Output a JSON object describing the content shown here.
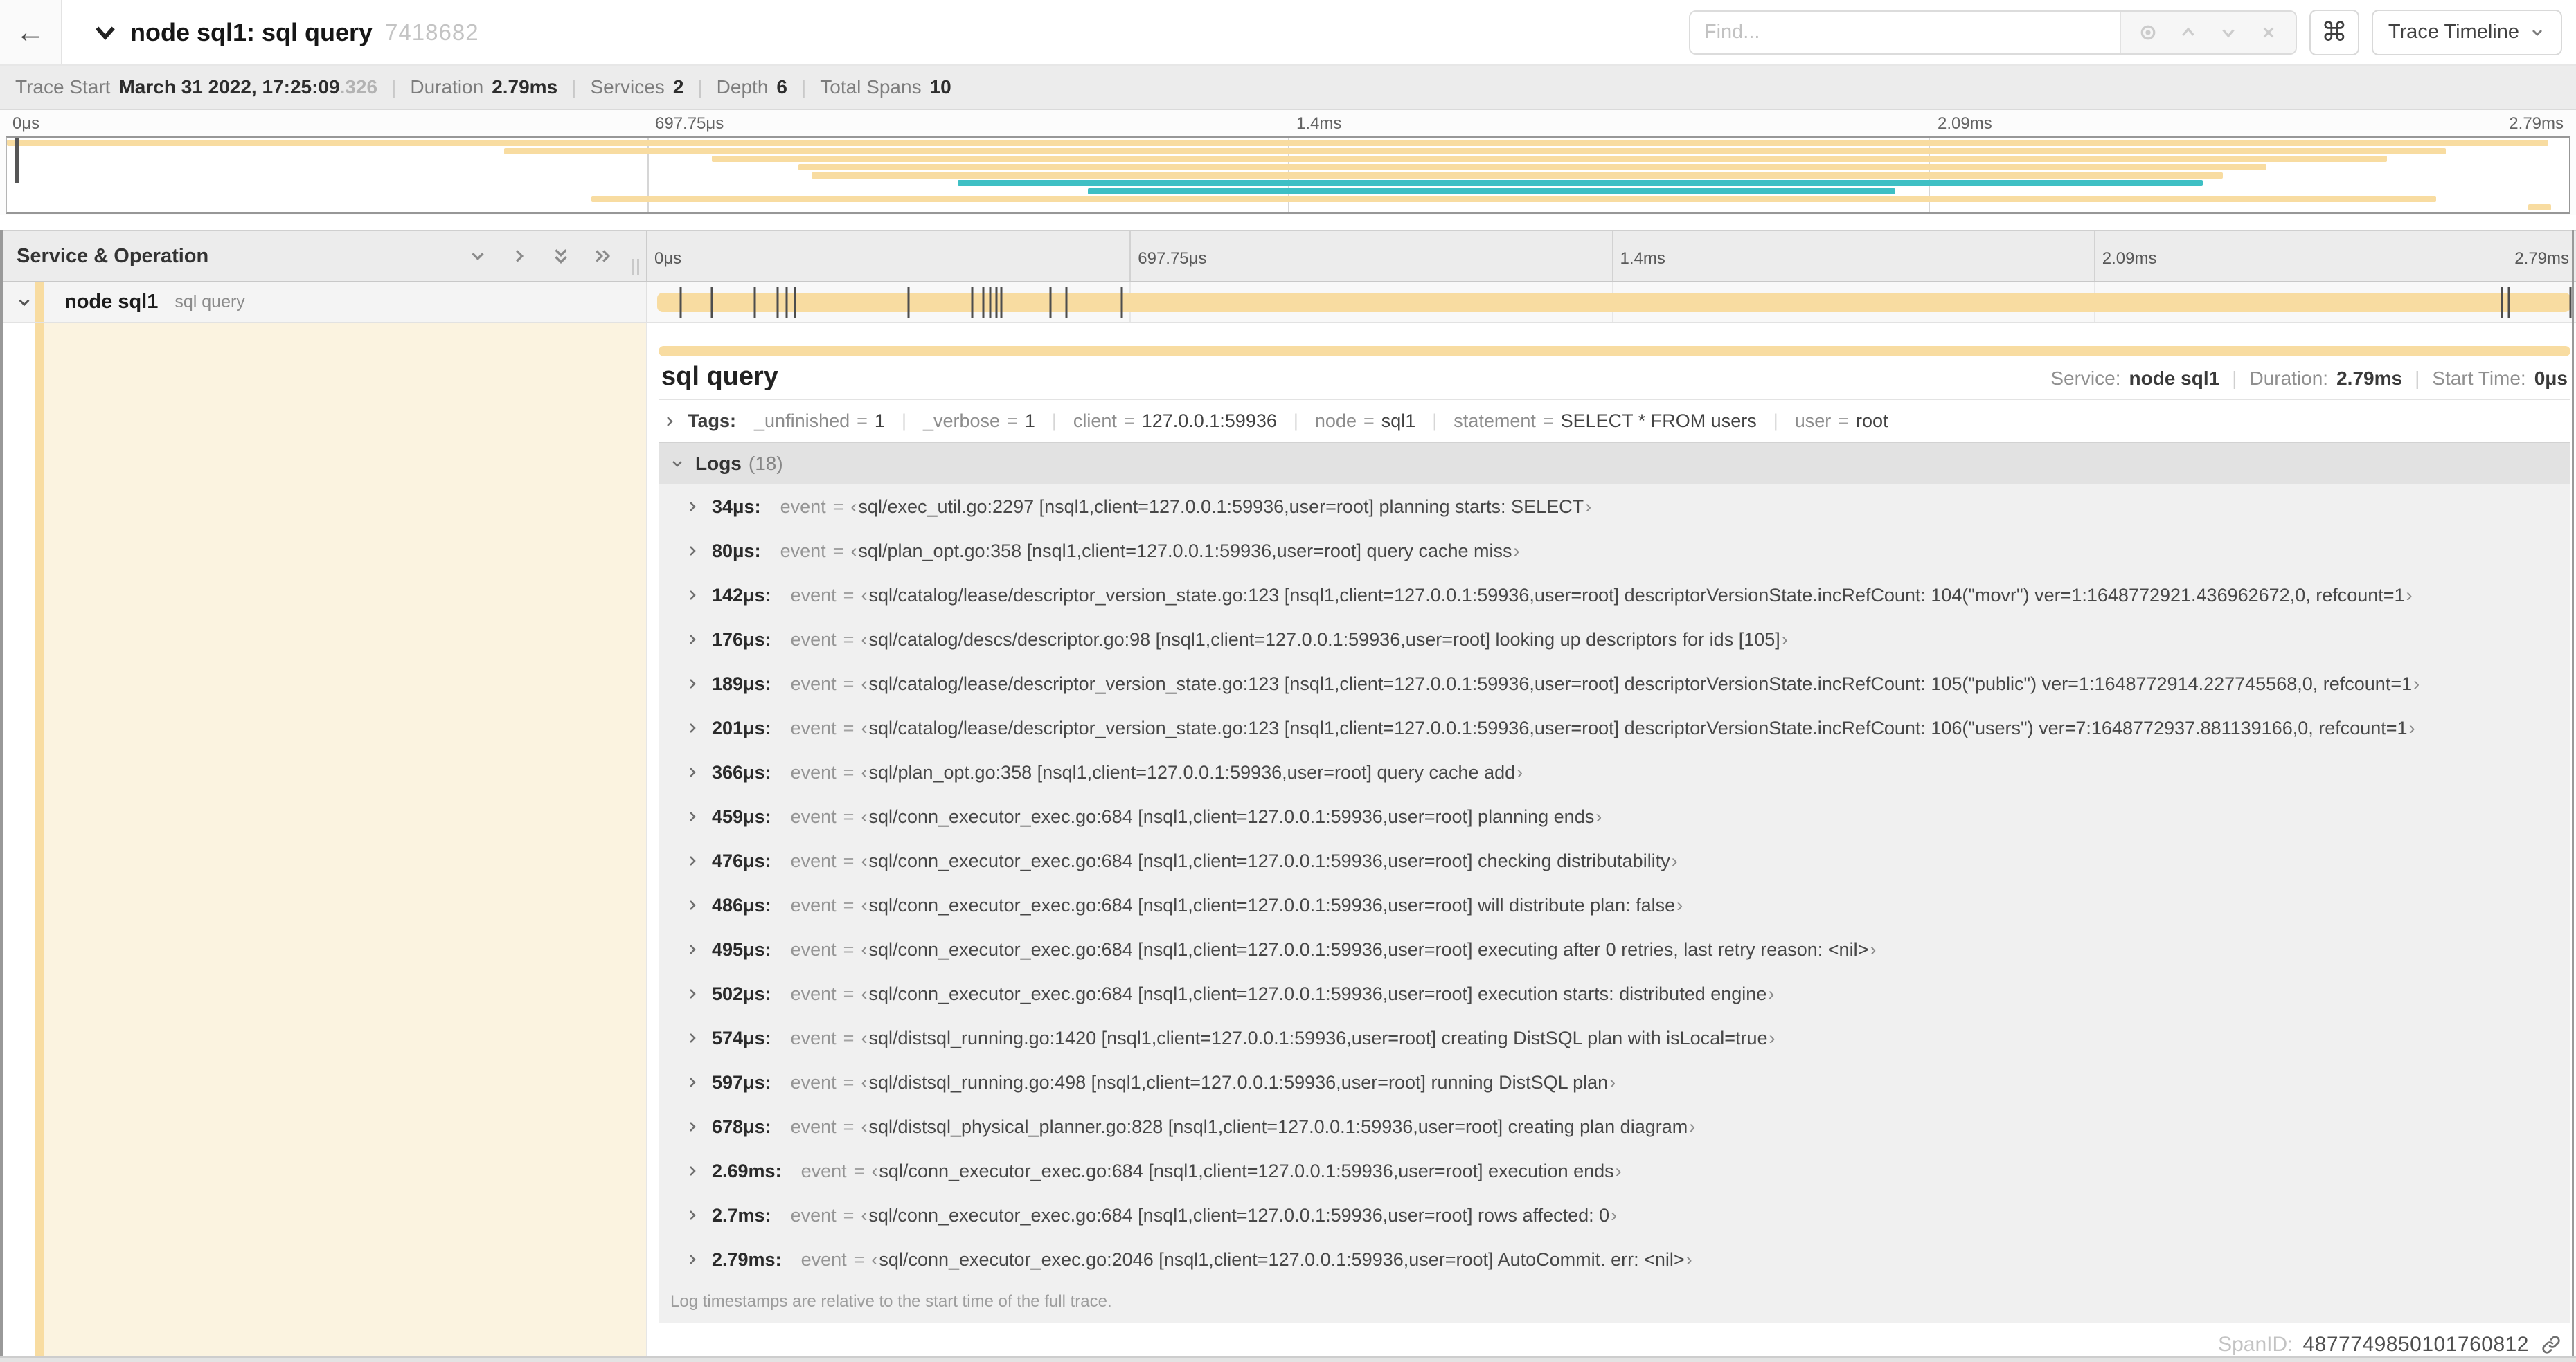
{
  "topbar": {
    "back_glyph": "←",
    "title": "node sql1: sql query",
    "trace_id": "7418682",
    "find_placeholder": "Find...",
    "shortcut_glyph": "⌘",
    "view_selector": "Trace Timeline"
  },
  "summary": {
    "items": [
      {
        "label": "Trace Start",
        "value": "March 31 2022, 17:25:09",
        "suffix": ".326"
      },
      {
        "label": "Duration",
        "value": "2.79ms"
      },
      {
        "label": "Services",
        "value": "2"
      },
      {
        "label": "Depth",
        "value": "6"
      },
      {
        "label": "Total Spans",
        "value": "10"
      }
    ]
  },
  "axis": {
    "ticks": [
      {
        "label": "0μs",
        "pos": 0,
        "align": "left"
      },
      {
        "label": "697.75μs",
        "pos": 25,
        "align": "left"
      },
      {
        "label": "1.4ms",
        "pos": 50,
        "align": "left"
      },
      {
        "label": "2.09ms",
        "pos": 75,
        "align": "left"
      },
      {
        "label": "2.79ms",
        "pos": 100,
        "align": "right"
      }
    ]
  },
  "minimap": {
    "colors": {
      "tan": "#F8DCA1",
      "teal": "#3EBFC4"
    },
    "spans": [
      {
        "s": 0,
        "e": 99.2,
        "color": "#F8DCA1"
      },
      {
        "s": 19.4,
        "e": 95.2,
        "color": "#F8DCA1"
      },
      {
        "s": 27.5,
        "e": 92.9,
        "color": "#F8DCA1"
      },
      {
        "s": 30.9,
        "e": 88.2,
        "color": "#F8DCA1"
      },
      {
        "s": 31.4,
        "e": 86.5,
        "color": "#F8DCA1"
      },
      {
        "s": 37.1,
        "e": 85.7,
        "color": "#3EBFC4"
      },
      {
        "s": 42.2,
        "e": 73.7,
        "color": "#3EBFC4"
      },
      {
        "s": 22.8,
        "e": 94.8,
        "color": "#F8DCA1"
      },
      {
        "s": 98.4,
        "e": 99.3,
        "color": "#F8DCA1"
      }
    ]
  },
  "timeline": {
    "header": "Service & Operation",
    "row": {
      "service": "node sql1",
      "operation": "sql query",
      "bar_color": "#F8DCA1"
    },
    "log_tick_pct": [
      1.22,
      2.87,
      5.09,
      6.31,
      6.77,
      7.2,
      13.12,
      16.45,
      17.06,
      17.42,
      17.74,
      17.99,
      20.57,
      21.4,
      24.3,
      96.42,
      96.77,
      100
    ]
  },
  "detail": {
    "title": "sql query",
    "service_label": "Service:",
    "service": "node sql1",
    "duration_label": "Duration:",
    "duration": "2.79ms",
    "start_label": "Start Time:",
    "start": "0μs",
    "tags": {
      "label": "Tags:",
      "items": [
        {
          "key": "_unfinished",
          "value": "1"
        },
        {
          "key": "_verbose",
          "value": "1"
        },
        {
          "key": "client",
          "value": "127.0.0.1:59936"
        },
        {
          "key": "node",
          "value": "sql1"
        },
        {
          "key": "statement",
          "value": "SELECT * FROM users"
        },
        {
          "key": "user",
          "value": "root"
        }
      ]
    },
    "logs": {
      "label": "Logs",
      "count": "(18)",
      "entries": [
        {
          "time": "34μs",
          "key": "event",
          "value": "sql/exec_util.go:2297 [nsql1,client=127.0.0.1:59936,user=root] planning starts: SELECT"
        },
        {
          "time": "80μs",
          "key": "event",
          "value": "sql/plan_opt.go:358 [nsql1,client=127.0.0.1:59936,user=root] query cache miss"
        },
        {
          "time": "142μs",
          "key": "event",
          "value": "sql/catalog/lease/descriptor_version_state.go:123 [nsql1,client=127.0.0.1:59936,user=root] descriptorVersionState.incRefCount: 104(\"movr\") ver=1:1648772921.436962672,0, refcount=1"
        },
        {
          "time": "176μs",
          "key": "event",
          "value": "sql/catalog/descs/descriptor.go:98 [nsql1,client=127.0.0.1:59936,user=root] looking up descriptors for ids [105]"
        },
        {
          "time": "189μs",
          "key": "event",
          "value": "sql/catalog/lease/descriptor_version_state.go:123 [nsql1,client=127.0.0.1:59936,user=root] descriptorVersionState.incRefCount: 105(\"public\") ver=1:1648772914.227745568,0, refcount=1"
        },
        {
          "time": "201μs",
          "key": "event",
          "value": "sql/catalog/lease/descriptor_version_state.go:123 [nsql1,client=127.0.0.1:59936,user=root] descriptorVersionState.incRefCount: 106(\"users\") ver=7:1648772937.881139166,0, refcount=1"
        },
        {
          "time": "366μs",
          "key": "event",
          "value": "sql/plan_opt.go:358 [nsql1,client=127.0.0.1:59936,user=root] query cache add"
        },
        {
          "time": "459μs",
          "key": "event",
          "value": "sql/conn_executor_exec.go:684 [nsql1,client=127.0.0.1:59936,user=root] planning ends"
        },
        {
          "time": "476μs",
          "key": "event",
          "value": "sql/conn_executor_exec.go:684 [nsql1,client=127.0.0.1:59936,user=root] checking distributability"
        },
        {
          "time": "486μs",
          "key": "event",
          "value": "sql/conn_executor_exec.go:684 [nsql1,client=127.0.0.1:59936,user=root] will distribute plan: false"
        },
        {
          "time": "495μs",
          "key": "event",
          "value": "sql/conn_executor_exec.go:684 [nsql1,client=127.0.0.1:59936,user=root] executing after 0 retries, last retry reason: <nil>"
        },
        {
          "time": "502μs",
          "key": "event",
          "value": "sql/conn_executor_exec.go:684 [nsql1,client=127.0.0.1:59936,user=root] execution starts: distributed engine"
        },
        {
          "time": "574μs",
          "key": "event",
          "value": "sql/distsql_running.go:1420 [nsql1,client=127.0.0.1:59936,user=root] creating DistSQL plan with isLocal=true"
        },
        {
          "time": "597μs",
          "key": "event",
          "value": "sql/distsql_running.go:498 [nsql1,client=127.0.0.1:59936,user=root] running DistSQL plan"
        },
        {
          "time": "678μs",
          "key": "event",
          "value": "sql/distsql_physical_planner.go:828 [nsql1,client=127.0.0.1:59936,user=root] creating plan diagram"
        },
        {
          "time": "2.69ms",
          "key": "event",
          "value": "sql/conn_executor_exec.go:684 [nsql1,client=127.0.0.1:59936,user=root] execution ends"
        },
        {
          "time": "2.7ms",
          "key": "event",
          "value": "sql/conn_executor_exec.go:684 [nsql1,client=127.0.0.1:59936,user=root] rows affected: 0"
        },
        {
          "time": "2.79ms",
          "key": "event",
          "value": "sql/conn_executor_exec.go:2046 [nsql1,client=127.0.0.1:59936,user=root] AutoCommit. err: <nil>"
        }
      ],
      "footnote": "Log timestamps are relative to the start time of the full trace."
    },
    "span_id_label": "SpanID:",
    "span_id": "4877749850101760812"
  }
}
